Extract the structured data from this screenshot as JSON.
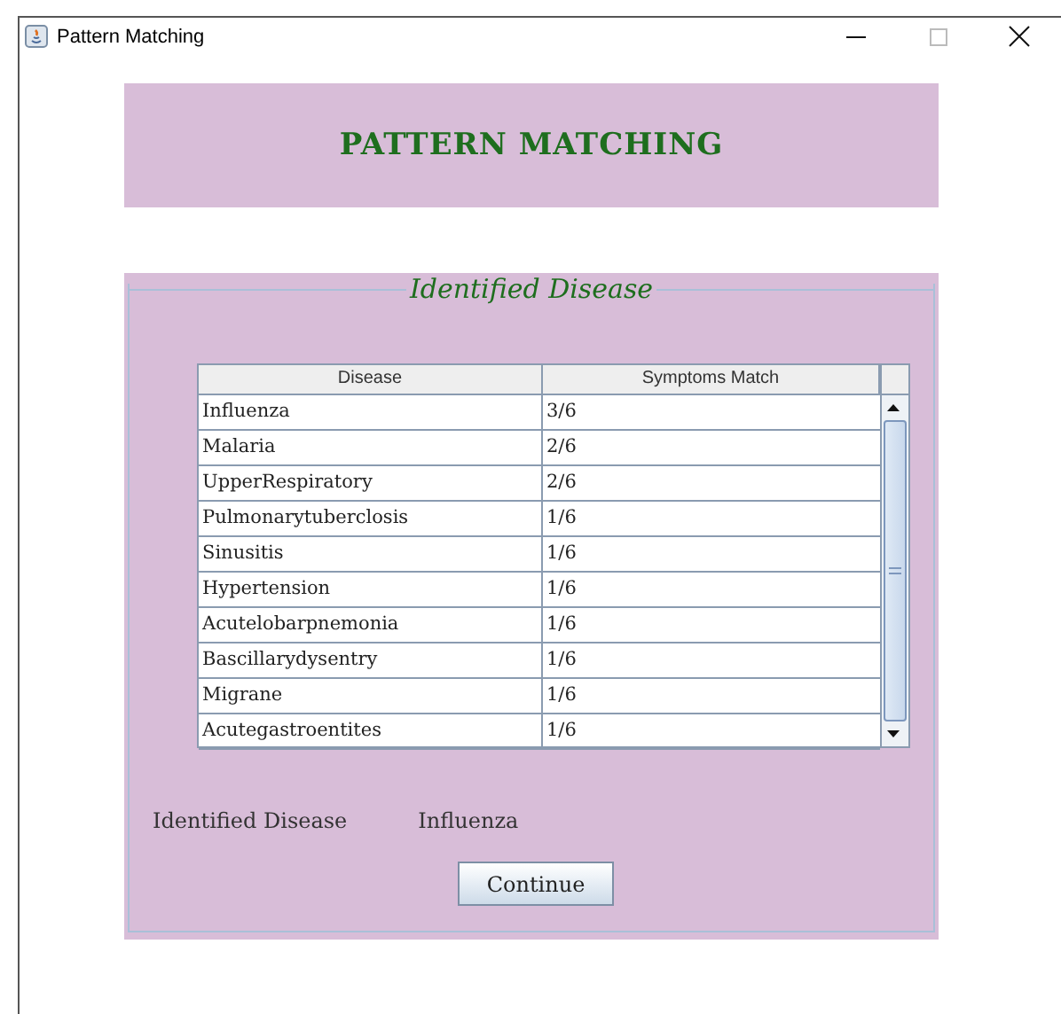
{
  "window": {
    "title": "Pattern Matching"
  },
  "banner": {
    "title": "PATTERN MATCHING"
  },
  "panel": {
    "title": "Identified Disease",
    "table": {
      "columns": [
        "Disease",
        "Symptoms Match"
      ],
      "rows": [
        {
          "disease": "Influenza",
          "match": "3/6"
        },
        {
          "disease": "Malaria",
          "match": "2/6"
        },
        {
          "disease": "UpperRespiratory",
          "match": "2/6"
        },
        {
          "disease": "Pulmonarytuberclosis",
          "match": "1/6"
        },
        {
          "disease": "Sinusitis",
          "match": "1/6"
        },
        {
          "disease": "Hypertension",
          "match": "1/6"
        },
        {
          "disease": "Acutelobarpnemonia",
          "match": "1/6"
        },
        {
          "disease": "Bascillarydysentry",
          "match": "1/6"
        },
        {
          "disease": "Migrane",
          "match": "1/6"
        },
        {
          "disease": "Acutegastroentites",
          "match": "1/6"
        }
      ]
    },
    "result_label": "Identified Disease",
    "result_value": "Influenza",
    "button": "Continue"
  }
}
